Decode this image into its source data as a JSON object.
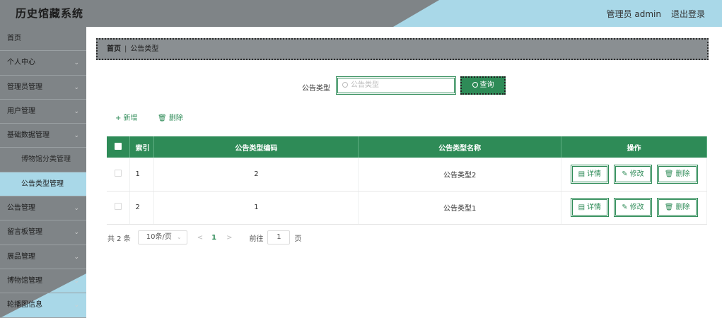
{
  "header": {
    "title": "历史馆藏系统",
    "user": "管理员 admin",
    "logout": "退出登录"
  },
  "sidebar": {
    "items": [
      {
        "label": "首页",
        "chevron": false
      },
      {
        "label": "个人中心",
        "chevron": true
      },
      {
        "label": "管理员管理",
        "chevron": true
      },
      {
        "label": "用户管理",
        "chevron": true
      },
      {
        "label": "基础数据管理",
        "chevron": true
      },
      {
        "label": "公告管理",
        "chevron": true
      },
      {
        "label": "留言板管理",
        "chevron": true
      },
      {
        "label": "展品管理",
        "chevron": true
      },
      {
        "label": "博物馆管理",
        "chevron": true
      },
      {
        "label": "轮播图信息",
        "chevron": true
      }
    ],
    "submenu": [
      {
        "label": "博物馆分类管理"
      },
      {
        "label": "公告类型管理",
        "active": true
      }
    ],
    "chevron": "⌄"
  },
  "breadcrumb": {
    "home": "首页",
    "separator": "|",
    "current": "公告类型"
  },
  "search": {
    "label": "公告类型",
    "placeholder": "公告类型",
    "button": "查询"
  },
  "actions": {
    "add": "+ 新增",
    "delete": "删除"
  },
  "table": {
    "headers": {
      "index": "索引",
      "code": "公告类型编码",
      "name": "公告类型名称",
      "ops": "操作"
    },
    "rows": [
      {
        "index": "1",
        "code": "2",
        "name": "公告类型2"
      },
      {
        "index": "2",
        "code": "1",
        "name": "公告类型1"
      }
    ],
    "ops": {
      "detail": "详情",
      "edit": "修改",
      "delete": "删除"
    }
  },
  "pagination": {
    "total": "共 2 条",
    "page_size": "10条/页",
    "prev": "<",
    "page": "1",
    "next": ">",
    "goto": "前往",
    "goto_value": "1",
    "page_suffix": "页"
  },
  "colors": {
    "primary": "#2e8b57",
    "header_bg": "#7f8487",
    "accent": "#a9d8e8"
  }
}
